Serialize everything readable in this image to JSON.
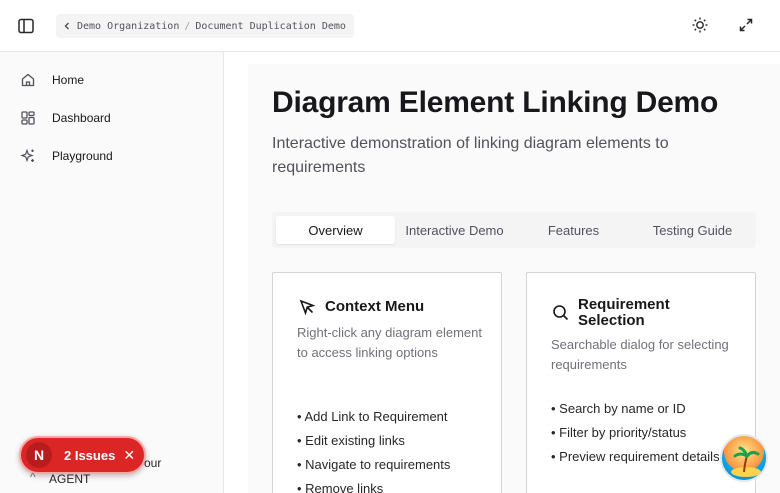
{
  "header": {
    "breadcrumb": [
      "Demo Organization",
      "Document Duplication Demo"
    ],
    "breadcrumb_separator": "/"
  },
  "sidebar": {
    "items": [
      {
        "label": "Home",
        "icon": "home-icon"
      },
      {
        "label": "Dashboard",
        "icon": "dashboard-icon"
      },
      {
        "label": "Playground",
        "icon": "sparkles-icon"
      }
    ],
    "agent_text_1": "our",
    "agent_text_2": "AGENT"
  },
  "issues_badge": {
    "letter": "N",
    "label": "2 Issues",
    "close": "✕"
  },
  "main": {
    "title": "Diagram Element Linking Demo",
    "subtitle": "Interactive demonstration of linking diagram elements to requirements",
    "tabs": [
      {
        "label": "Overview",
        "active": true
      },
      {
        "label": "Interactive Demo",
        "active": false
      },
      {
        "label": "Features",
        "active": false
      },
      {
        "label": "Testing Guide",
        "active": false
      }
    ],
    "cards": [
      {
        "icon": "cursor-pointer-icon",
        "title": "Context Menu",
        "description": "Right-click any diagram element to access linking options",
        "bullets": [
          "• Add Link to Requirement",
          "• Edit existing links",
          "• Navigate to requirements",
          "• Remove links"
        ]
      },
      {
        "icon": "search-icon",
        "title": "Requirement Selection",
        "description": "Searchable dialog for selecting requirements",
        "bullets": [
          "• Search by name or ID",
          "• Filter by priority/status",
          "• Preview requirement details"
        ]
      }
    ]
  },
  "colors": {
    "accent": "#dc2626",
    "muted_text": "#71717a",
    "border": "#e5e7eb"
  }
}
